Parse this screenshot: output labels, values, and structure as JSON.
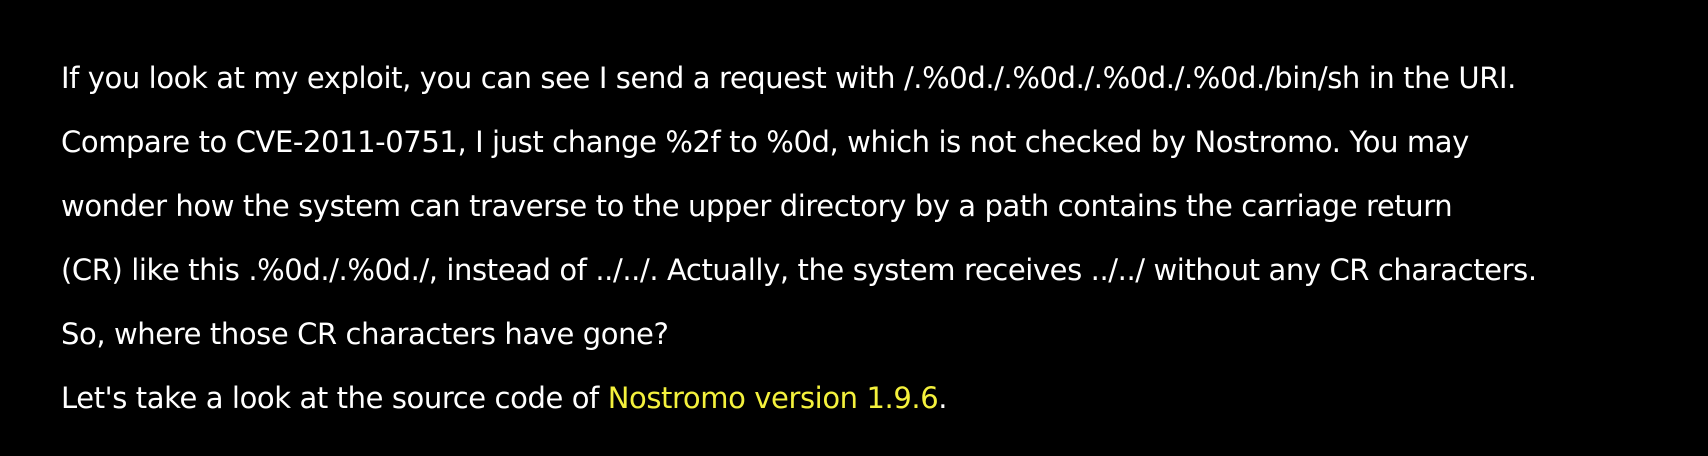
{
  "article": {
    "paragraph1": {
      "lines": [
        "If you look at my exploit, you can see I send a request with /.%0d./.%0d./.%0d./.%0d./bin/sh in the URI.",
        "Compare to CVE-2011-0751, I just change %2f to %0d, which is not checked by Nostromo. You may",
        "wonder how the system can traverse to the upper directory by a path contains the carriage return",
        "(CR) like this .%0d./.%0d./, instead of ../../. Actually, the system receives ../../ without any CR characters.",
        "So, where those CR characters have gone?"
      ]
    },
    "paragraph2": {
      "text_before": "Let's take a look at the source code of ",
      "link_text": "Nostromo version 1.9.6",
      "text_after": "."
    }
  },
  "colors": {
    "background": "#000000",
    "text": "#ffffff",
    "link": "#f4f13c"
  }
}
